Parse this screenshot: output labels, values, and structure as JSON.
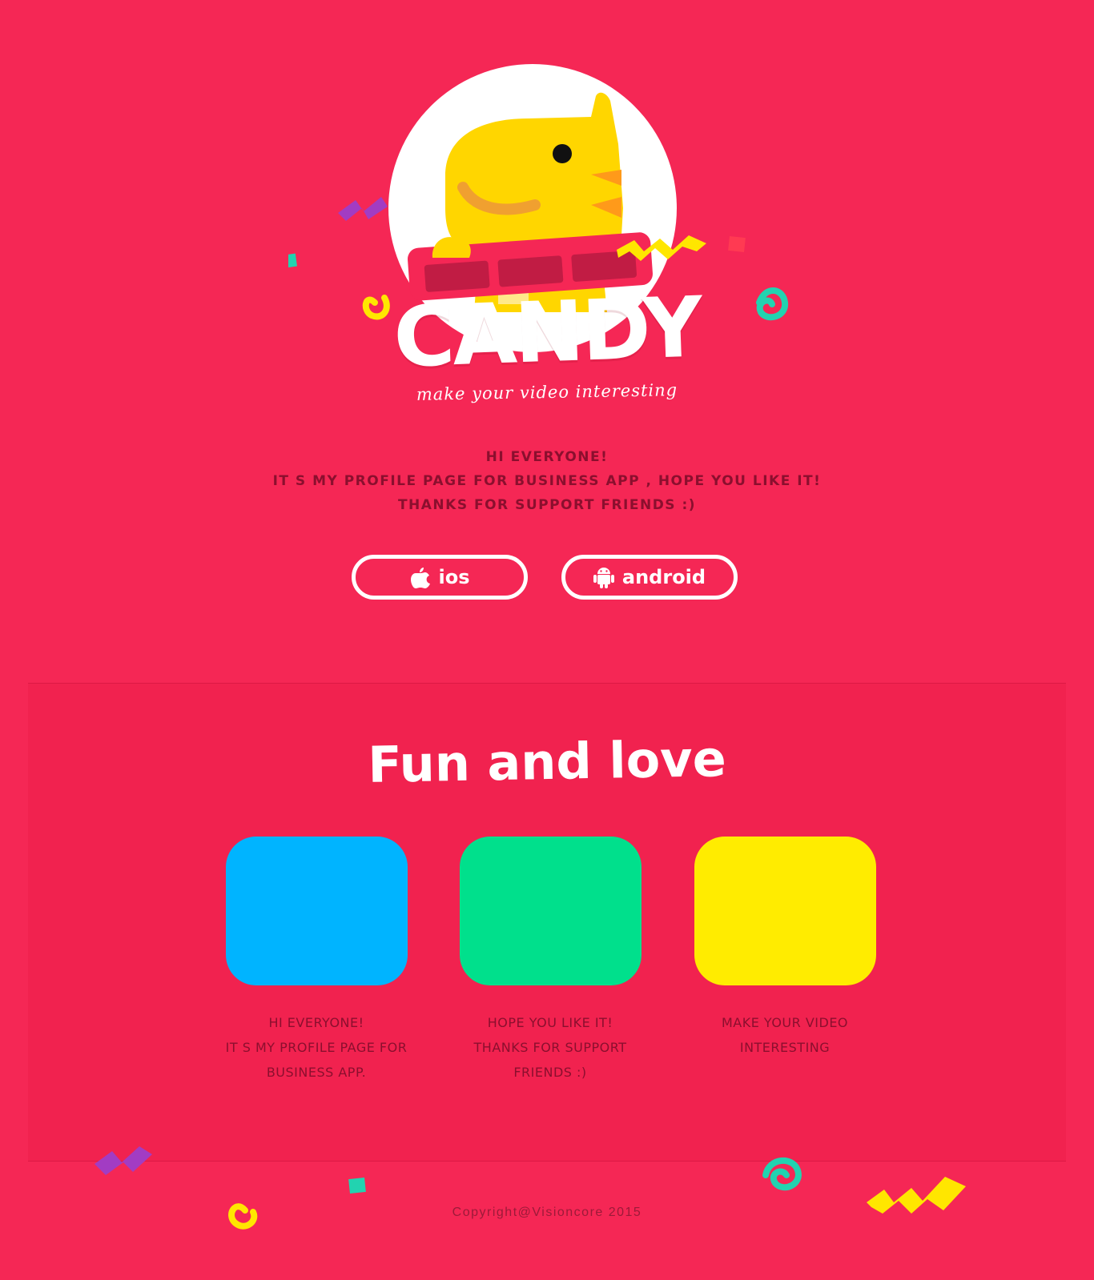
{
  "brand": {
    "name": "CANDY",
    "tagline": "make your video interesting"
  },
  "intro": {
    "lines": [
      "HI EVERYONE!",
      "IT S MY PROFILE PAGE FOR BUSINESS APP , HOPE YOU LIKE IT!",
      "THANKS FOR SUPPORT FRIENDS :)"
    ]
  },
  "download_buttons": [
    {
      "label": "ios",
      "icon": "apple-icon"
    },
    {
      "label": "android",
      "icon": "android-icon"
    }
  ],
  "features": {
    "title": "Fun and love",
    "items": [
      {
        "color": "#00b4ff",
        "lines": [
          "HI EVERYONE!",
          "IT S MY PROFILE PAGE FOR",
          "BUSINESS APP."
        ]
      },
      {
        "color": "#00e08c",
        "lines": [
          "HOPE YOU LIKE IT!",
          "THANKS FOR SUPPORT",
          "FRIENDS :)"
        ]
      },
      {
        "color": "#ffec00",
        "lines": [
          "MAKE YOUR VIDEO",
          "INTERESTING"
        ]
      }
    ]
  },
  "footer": {
    "copyright": "Copyright@Visioncore 2015"
  },
  "colors": {
    "background": "#f52755",
    "section_background": "#f1224f",
    "text_dark": "#8b0f2e",
    "mascot_yellow": "#ffd600",
    "confetti_purple": "#a23cc3",
    "confetti_teal": "#22d3b0",
    "confetti_yellow": "#ffe600"
  }
}
